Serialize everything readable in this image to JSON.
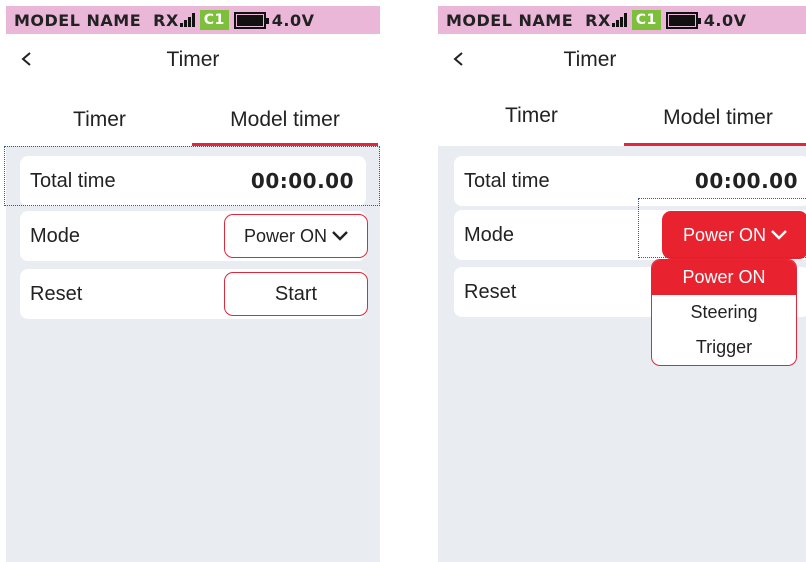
{
  "screens": [
    {
      "status": {
        "model_name": "MODEL NAME",
        "rx": "RX",
        "channel": "C1",
        "voltage": "4.0V"
      },
      "header": {
        "title": "Timer"
      },
      "tabs": [
        {
          "label": "Timer"
        },
        {
          "label": "Model timer",
          "active": true
        }
      ],
      "rows": {
        "total_time": {
          "label": "Total time",
          "value": "00:00.00"
        },
        "mode": {
          "label": "Mode",
          "value": "Power ON"
        },
        "reset": {
          "label": "Reset",
          "button": "Start"
        }
      }
    },
    {
      "status": {
        "model_name": "MODEL NAME",
        "rx": "RX",
        "channel": "C1",
        "voltage": "4.0V"
      },
      "header": {
        "title": "Timer"
      },
      "tabs": [
        {
          "label": "Timer"
        },
        {
          "label": "Model timer",
          "active": true
        }
      ],
      "rows": {
        "total_time": {
          "label": "Total time",
          "value": "00:00.00"
        },
        "mode": {
          "label": "Mode",
          "value": "Power ON"
        },
        "reset": {
          "label": "Reset"
        }
      },
      "dropdown": {
        "options": [
          "Power ON",
          "Steering",
          "Trigger"
        ],
        "selected": "Power ON"
      }
    }
  ],
  "colors": {
    "status_bar": "#eab7d8",
    "channel_badge": "#7cbf3a",
    "accent_red": "#e0283c",
    "background": "#e9edf2",
    "focus_outline": "#2857b8"
  }
}
